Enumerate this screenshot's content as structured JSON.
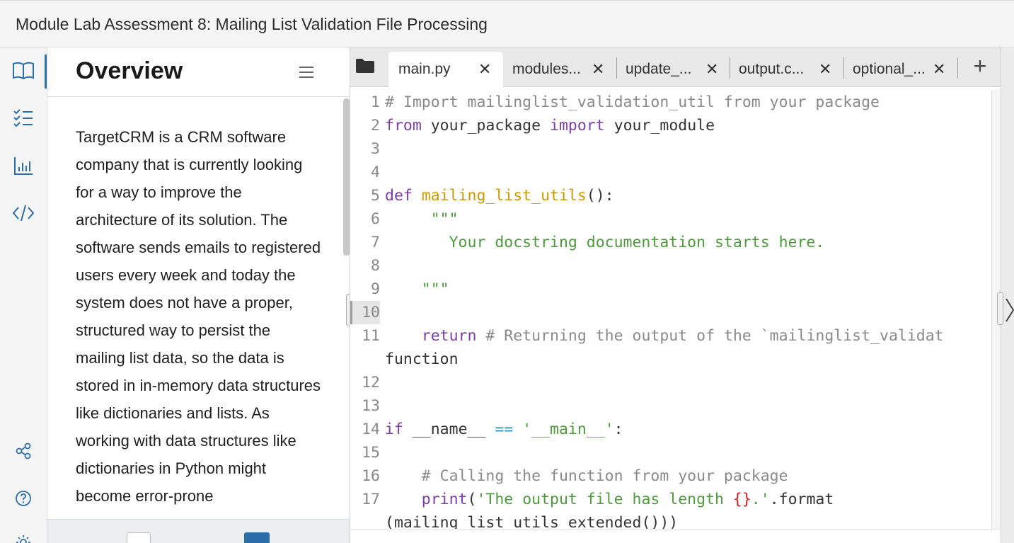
{
  "window": {
    "title": "Module Lab Assessment 8: Mailing List Validation File Processing"
  },
  "rail": {
    "icons": [
      "book-icon",
      "checklist-icon",
      "bar-chart-icon",
      "code-icon",
      "share-icon",
      "help-icon",
      "settings-icon"
    ]
  },
  "overview": {
    "title": "Overview",
    "text": "TargetCRM is a CRM software company that is currently looking for a way to improve the architecture of its solution. The software sends emails to registered users every week and today the system does not have a proper, structured way to persist the mailing list data, so the data is stored in in-memory data structures like dictionaries and lists. As working with data structures like dictionaries in Python might become error-prone"
  },
  "tabs": [
    {
      "label": "main.py",
      "active": true
    },
    {
      "label": "modules...",
      "active": false
    },
    {
      "label": "update_...",
      "active": false
    },
    {
      "label": "output.c...",
      "active": false
    },
    {
      "label": "optional_...",
      "active": false
    }
  ],
  "editor": {
    "line_numbers": [
      "1",
      "2",
      "3",
      "4",
      "5",
      "6",
      "7",
      "8",
      "9",
      "10",
      "11",
      "",
      "12",
      "13",
      "14",
      "15",
      "16",
      "17"
    ],
    "highlighted_line": "10",
    "lines": [
      "# Import mailinglist_validation_util from your package",
      "from your_package import your_module",
      "",
      "",
      "def mailing_list_utils():",
      "     \"\"\"",
      "       Your docstring documentation starts here.",
      "",
      "    \"\"\"",
      "",
      "    return # Returning the output of the `mailinglist_validat",
      "function",
      "",
      "",
      "if __name__ == '__main__':",
      "",
      "    # Calling the function from your package",
      "    print('The output file has length {}.'.format",
      "(mailing_list_utils_extended()))"
    ]
  },
  "colors": {
    "accent": "#2b6ea8",
    "keyword": "#7b3ea1",
    "function_name": "#c99a00",
    "string": "#4f9a3e",
    "comment": "#8a8a8a",
    "operator": "#2a8fb5",
    "brace": "#c82121"
  }
}
